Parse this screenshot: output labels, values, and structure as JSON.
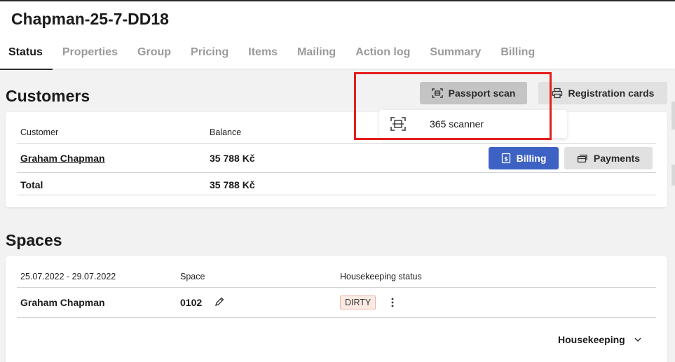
{
  "header": {
    "title": "Chapman-25-7-DD18",
    "tabs": [
      {
        "label": "Status",
        "active": true
      },
      {
        "label": "Properties"
      },
      {
        "label": "Group"
      },
      {
        "label": "Pricing"
      },
      {
        "label": "Items"
      },
      {
        "label": "Mailing"
      },
      {
        "label": "Action log"
      },
      {
        "label": "Summary"
      },
      {
        "label": "Billing"
      }
    ]
  },
  "customers": {
    "title": "Customers",
    "passport_scan_label": "Passport scan",
    "registration_cards_label": "Registration cards",
    "dropdown_item_label": "365 scanner",
    "columns": {
      "customer": "Customer",
      "balance": "Balance"
    },
    "rows": [
      {
        "customer": "Graham Chapman",
        "balance": "35 788 Kč"
      }
    ],
    "total": {
      "label": "Total",
      "balance": "35 788 Kč"
    },
    "billing_label": "Billing",
    "payments_label": "Payments"
  },
  "spaces": {
    "title": "Spaces",
    "columns": {
      "dates": "25.07.2022 - 29.07.2022",
      "space": "Space",
      "housekeeping": "Housekeeping status"
    },
    "rows": [
      {
        "guest": "Graham Chapman",
        "space": "0102",
        "status": "DIRTY"
      }
    ],
    "housekeeping_label": "Housekeeping"
  },
  "colors": {
    "accent_blue": "#3d62c4",
    "highlight_red": "#e51e1e",
    "dirty_badge_bg": "#fbeae4"
  }
}
